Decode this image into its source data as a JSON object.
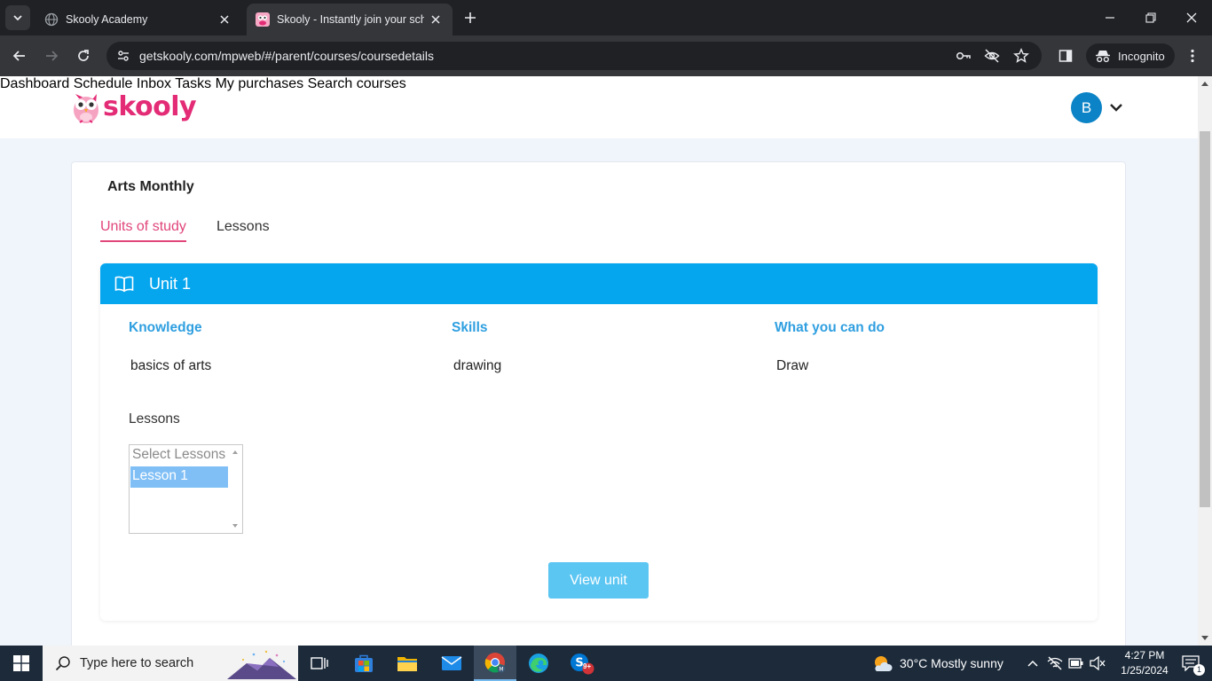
{
  "browser": {
    "tabs": [
      {
        "title": "Skooly Academy",
        "active": false
      },
      {
        "title": "Skooly - Instantly join your scho",
        "active": true
      }
    ],
    "url": "getskooly.com/mpweb/#/parent/courses/coursedetails",
    "incognito_label": "Incognito"
  },
  "header": {
    "logo_text": "skooly",
    "nav": [
      "Dashboard",
      "Schedule",
      "Inbox",
      "Tasks",
      "My purchases",
      "Search courses"
    ],
    "avatar_initial": "B"
  },
  "course": {
    "title": "Arts Monthly",
    "tabs": [
      "Units of study",
      "Lessons"
    ],
    "active_tab": "Units of study",
    "unit": {
      "title": "Unit 1",
      "columns": [
        {
          "heading": "Knowledge",
          "value": "basics of arts"
        },
        {
          "heading": "Skills",
          "value": "drawing"
        },
        {
          "heading": "What you can do",
          "value": "Draw"
        }
      ],
      "lessons_label": "Lessons",
      "lessons_placeholder": "Select Lessons",
      "lessons": [
        "Lesson 1"
      ],
      "selected_lesson": "Lesson 1",
      "view_button": "View unit"
    }
  },
  "taskbar": {
    "search_placeholder": "Type here to search",
    "weather": "30°C  Mostly sunny",
    "time": "4:27 PM",
    "date": "1/25/2024",
    "skype_badge": "9+",
    "notification_count": "1"
  },
  "colors": {
    "brand": "#e32b76",
    "unit_header": "#06a6ef",
    "column_heading": "#2f9fe0",
    "button": "#5cc6f3",
    "selected_option": "#80bff6",
    "avatar": "#0b83c6"
  }
}
